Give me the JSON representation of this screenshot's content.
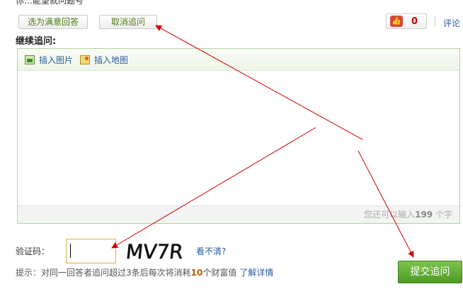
{
  "top_cut_text": "你…能望就问题号",
  "buttons": {
    "select_best": "选为满意回答",
    "cancel_followup": "取消追问",
    "submit": "提交追问"
  },
  "thumb": {
    "icon": "thumbs-up-icon",
    "count": "0"
  },
  "comment_link": "评论",
  "section_title": "继续追问:",
  "toolbar": {
    "insert_image": "插入图片",
    "insert_map": "插入地图"
  },
  "editor": {
    "textarea_value": "",
    "remaining_prefix": "您还可以输入",
    "remaining_count": "199",
    "remaining_suffix": "个字"
  },
  "captcha": {
    "label": "验证码：",
    "input_value": "",
    "image_text": "MV7R",
    "refresh_link": "看不清?"
  },
  "tip": {
    "prefix": "提示：对同一回答者追问超过3条后每次将消耗",
    "cost": "10",
    "suffix": "个财富值",
    "more_link": "了解详情"
  },
  "colors": {
    "link": "#2b5d9e",
    "accent_green": "#4f9a26",
    "annotation_arrow": "#d40000"
  }
}
